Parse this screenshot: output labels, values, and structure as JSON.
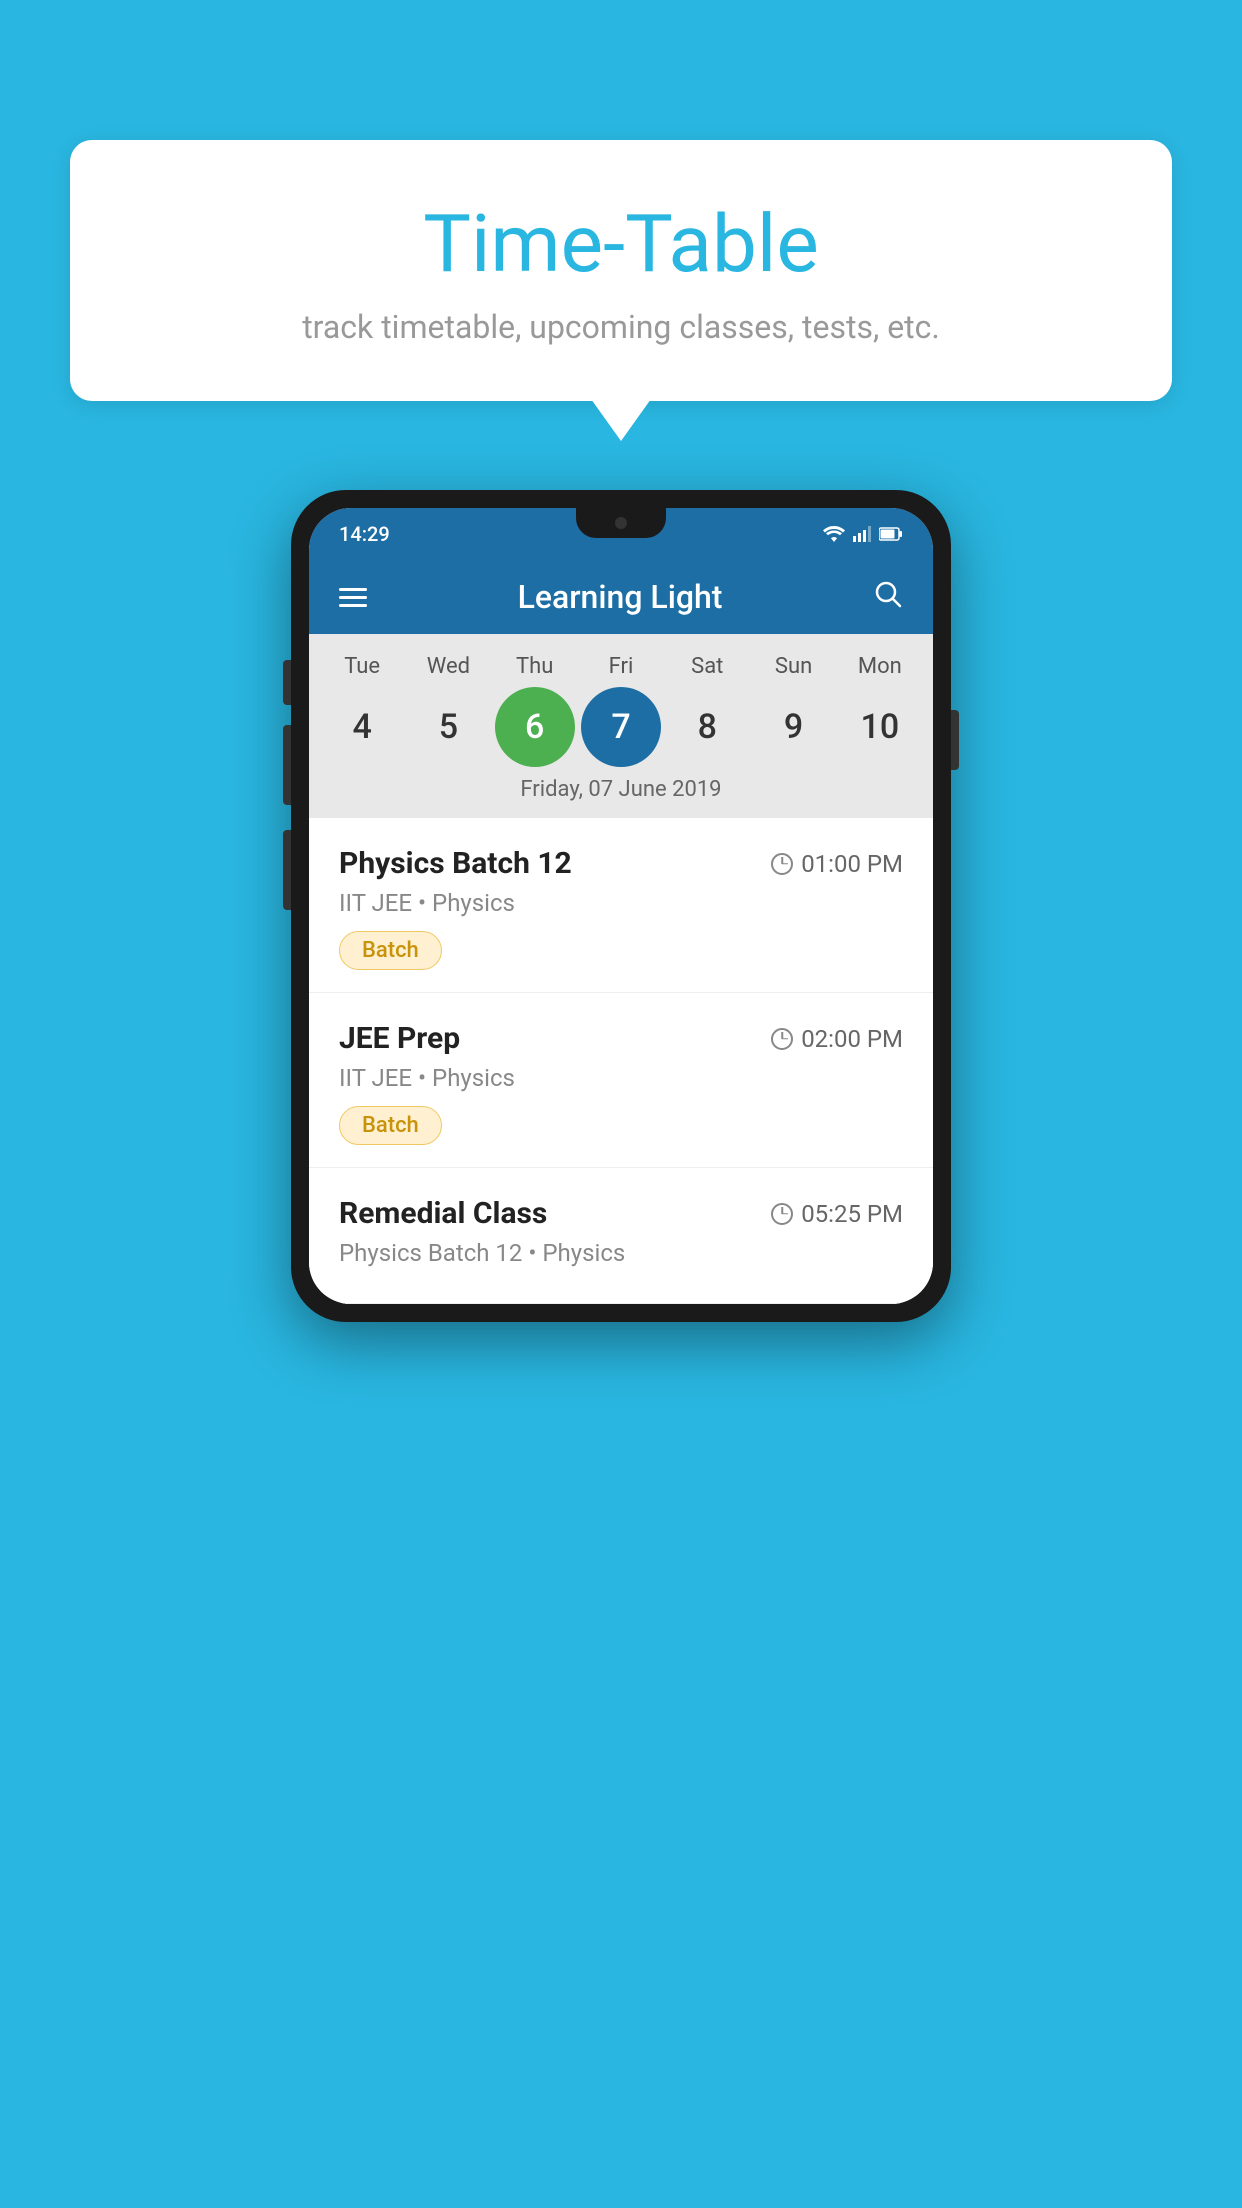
{
  "background_color": "#29b6e0",
  "bubble": {
    "title": "Time-Table",
    "subtitle": "track timetable, upcoming classes, tests, etc."
  },
  "phone": {
    "status_time": "14:29",
    "app_title": "Learning Light",
    "calendar": {
      "days": [
        {
          "label": "Tue",
          "num": "4"
        },
        {
          "label": "Wed",
          "num": "5"
        },
        {
          "label": "Thu",
          "num": "6",
          "state": "today"
        },
        {
          "label": "Fri",
          "num": "7",
          "state": "selected"
        },
        {
          "label": "Sat",
          "num": "8"
        },
        {
          "label": "Sun",
          "num": "9"
        },
        {
          "label": "Mon",
          "num": "10"
        }
      ],
      "selected_date": "Friday, 07 June 2019"
    },
    "schedule": [
      {
        "title": "Physics Batch 12",
        "time": "01:00 PM",
        "subtitle": "IIT JEE • Physics",
        "badge": "Batch"
      },
      {
        "title": "JEE Prep",
        "time": "02:00 PM",
        "subtitle": "IIT JEE • Physics",
        "badge": "Batch"
      },
      {
        "title": "Remedial Class",
        "time": "05:25 PM",
        "subtitle": "Physics Batch 12 • Physics",
        "badge": null
      }
    ]
  }
}
